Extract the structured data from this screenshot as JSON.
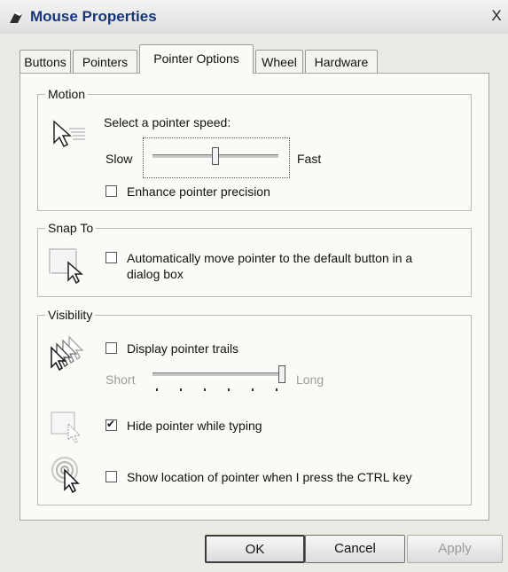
{
  "window": {
    "title": "Mouse Properties",
    "close_glyph": "X",
    "icon": "mouse-icon"
  },
  "tabs": [
    {
      "label": "Buttons",
      "active": false
    },
    {
      "label": "Pointers",
      "active": false
    },
    {
      "label": "Pointer Options",
      "active": true
    },
    {
      "label": "Wheel",
      "active": false
    },
    {
      "label": "Hardware",
      "active": false
    }
  ],
  "motion": {
    "legend": "Motion",
    "speed_label": "Select a pointer speed:",
    "slow_label": "Slow",
    "fast_label": "Fast",
    "speed_level": 0.5,
    "precision_label": "Enhance pointer precision",
    "precision_checked": false
  },
  "snap": {
    "legend": "Snap To",
    "label_line1": "Automatically move pointer to the default button in a",
    "label_line2": "dialog box",
    "checked": false
  },
  "visibility": {
    "legend": "Visibility",
    "trails_label": "Display pointer trails",
    "trails_checked": false,
    "short_label": "Short",
    "long_label": "Long",
    "trail_level": 1.0,
    "hide_label": "Hide pointer while typing",
    "hide_checked": true,
    "ctrl_label": "Show location of pointer when I press the CTRL key",
    "ctrl_checked": false
  },
  "buttons": {
    "ok": "OK",
    "cancel": "Cancel",
    "apply": "Apply"
  },
  "colors": {
    "title_text": "#16357a",
    "window_bg": "#eceae4",
    "panel_bg": "#fbfaf6"
  }
}
